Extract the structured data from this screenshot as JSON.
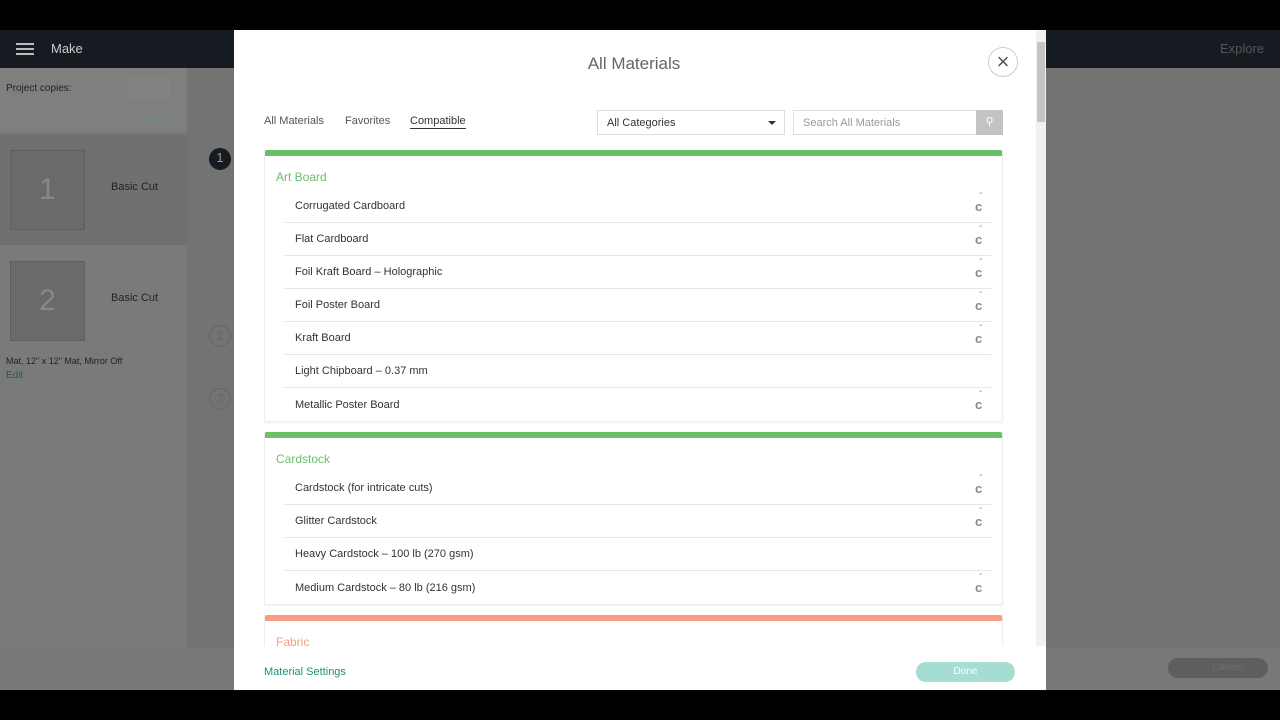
{
  "header": {
    "title": "Make",
    "explore": "Explore"
  },
  "sidebar": {
    "project_copies_label": "Project copies:",
    "apply": "Apply",
    "mats": [
      {
        "number": "1",
        "label": "Basic Cut"
      },
      {
        "number": "2",
        "label": "Basic Cut"
      }
    ],
    "mat_info": "Mat, 12\" x 12\" Mat, Mirror Off",
    "edit": "Edit"
  },
  "steps": [
    "1",
    "2",
    "3"
  ],
  "bottom": {
    "cancel": "Cancel"
  },
  "modal": {
    "title": "All Materials",
    "close_icon": "close-icon",
    "tabs": [
      {
        "label": "All Materials"
      },
      {
        "label": "Favorites"
      },
      {
        "label": "Compatible",
        "active": true
      }
    ],
    "category_select": "All Categories",
    "search_placeholder": "Search All Materials",
    "categories": [
      {
        "name": "Art Board",
        "color": "#6abf69",
        "items": [
          {
            "label": "Corrugated Cardboard",
            "cricut_icon": true
          },
          {
            "label": "Flat Cardboard",
            "cricut_icon": true
          },
          {
            "label": "Foil Kraft Board  – Holographic",
            "cricut_icon": true
          },
          {
            "label": "Foil Poster Board",
            "cricut_icon": true
          },
          {
            "label": "Kraft Board",
            "cricut_icon": true
          },
          {
            "label": "Light Chipboard – 0.37 mm",
            "cricut_icon": false
          },
          {
            "label": "Metallic Poster Board",
            "cricut_icon": true
          }
        ]
      },
      {
        "name": "Cardstock",
        "color": "#6abf69",
        "items": [
          {
            "label": "Cardstock (for intricate cuts)",
            "cricut_icon": true
          },
          {
            "label": "Glitter Cardstock",
            "cricut_icon": true
          },
          {
            "label": "Heavy Cardstock – 100 lb (270 gsm)",
            "cricut_icon": false
          },
          {
            "label": "Medium Cardstock – 80 lb (216 gsm)",
            "cricut_icon": true
          }
        ]
      },
      {
        "name": "Fabric",
        "color": "#f89c84",
        "items": []
      }
    ],
    "material_settings": "Material Settings",
    "done": "Done"
  }
}
